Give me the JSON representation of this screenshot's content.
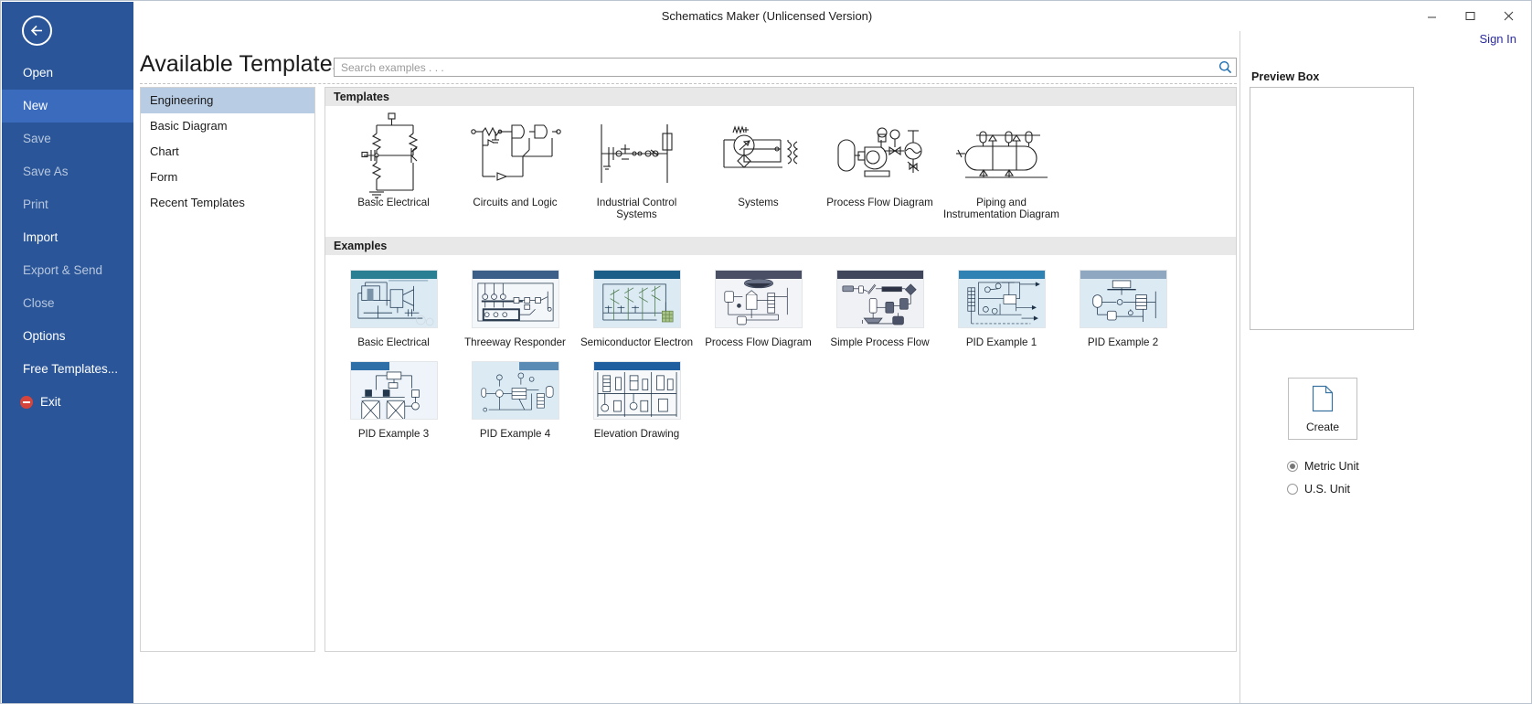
{
  "window": {
    "title": "Schematics Maker (Unlicensed Version)",
    "minimize_label": "Minimize",
    "maximize_label": "Maximize",
    "close_label": "Close"
  },
  "account": {
    "sign_in_label": "Sign In"
  },
  "sidebar": {
    "back_label": "Back",
    "items": [
      {
        "label": "Open",
        "state": "normal"
      },
      {
        "label": "New",
        "state": "active"
      },
      {
        "label": "Save",
        "state": "dim"
      },
      {
        "label": "Save As",
        "state": "dim"
      },
      {
        "label": "Print",
        "state": "dim"
      },
      {
        "label": "Import",
        "state": "normal"
      },
      {
        "label": "Export & Send",
        "state": "dim"
      },
      {
        "label": "Close",
        "state": "dim"
      },
      {
        "label": "Options",
        "state": "normal"
      },
      {
        "label": "Free Templates...",
        "state": "normal"
      },
      {
        "label": "Exit",
        "state": "exit"
      }
    ]
  },
  "main": {
    "headline": "Available Templates",
    "search": {
      "value": "",
      "placeholder": "Search examples . . ."
    },
    "categories": [
      {
        "label": "Engineering",
        "selected": true
      },
      {
        "label": "Basic Diagram",
        "selected": false
      },
      {
        "label": "Chart",
        "selected": false
      },
      {
        "label": "Form",
        "selected": false
      },
      {
        "label": "Recent Templates",
        "selected": false
      }
    ],
    "templates_section_title": "Templates",
    "templates": [
      {
        "label": "Basic Electrical",
        "icon": "basic-electrical-schematic-icon"
      },
      {
        "label": "Circuits and Logic",
        "icon": "circuits-and-logic-schematic-icon"
      },
      {
        "label": "Industrial Control Systems",
        "icon": "industrial-control-schematic-icon"
      },
      {
        "label": "Systems",
        "icon": "systems-schematic-icon"
      },
      {
        "label": "Process Flow Diagram",
        "icon": "process-flow-schematic-icon"
      },
      {
        "label": "Piping and Instrumentation Diagram",
        "icon": "piping-instrumentation-schematic-icon"
      }
    ],
    "examples_section_title": "Examples",
    "examples": [
      {
        "label": "Basic Electrical",
        "header_color": "#2b7f93"
      },
      {
        "label": "Threeway Responder",
        "header_color": "#3c5f8a"
      },
      {
        "label": "Semiconductor Electron",
        "header_color": "#1b5e87"
      },
      {
        "label": "Process Flow Diagram",
        "header_color": "#4a4f66"
      },
      {
        "label": "Simple Process Flow",
        "header_color": "#40465c"
      },
      {
        "label": "PID Example 1",
        "header_color": "#2f82b4"
      },
      {
        "label": "PID Example 2",
        "header_color": "#8fa7c0"
      },
      {
        "label": "PID Example 3",
        "header_color": "#2f6fa8"
      },
      {
        "label": "PID Example 4",
        "header_color": "#5a8bb5"
      },
      {
        "label": "Elevation Drawing",
        "header_color": "#1f5fa0"
      }
    ]
  },
  "preview": {
    "title": "Preview Box",
    "create_label": "Create",
    "units": [
      {
        "label": "Metric Unit",
        "selected": true
      },
      {
        "label": "U.S. Unit",
        "selected": false
      }
    ]
  },
  "colors": {
    "nav_background": "#2a5699",
    "nav_active": "#3a6bbd",
    "category_selected": "#b8cce4",
    "section_header": "#e8e8e8",
    "sign_in": "#2b2ba0",
    "example_thumb_bg": "#dceaf4"
  }
}
